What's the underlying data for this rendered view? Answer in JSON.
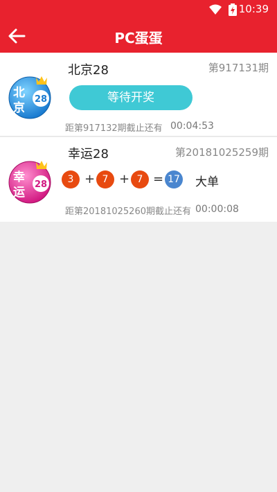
{
  "status_bar": {
    "time": "10:39",
    "icons": [
      "wifi-icon",
      "battery-charging-icon"
    ]
  },
  "app_bar": {
    "title": "PC蛋蛋",
    "back_icon": "arrow-left-icon"
  },
  "colors": {
    "header": "#e8222e",
    "wait_button": "#3fc9d5",
    "ball": "#e84a10",
    "sum_ball": "#4a86cf"
  },
  "games": [
    {
      "logo_text_top": "北",
      "logo_text_bottom": "京",
      "logo_number": "28",
      "name": "北京28",
      "issue": "第917131期",
      "button_label": "等待开奖",
      "deadline_label": "距第917132期截止还有",
      "countdown": "00:04:53"
    },
    {
      "logo_text_top": "幸",
      "logo_text_bottom": "运",
      "logo_number": "28",
      "name": "幸运28",
      "issue": "第20181025259期",
      "balls": [
        "3",
        "7",
        "7"
      ],
      "plus": "+",
      "equals": "=",
      "sum": "17",
      "result": "大单",
      "deadline_label": "距第20181025260期截止还有",
      "countdown": "00:00:08"
    }
  ]
}
